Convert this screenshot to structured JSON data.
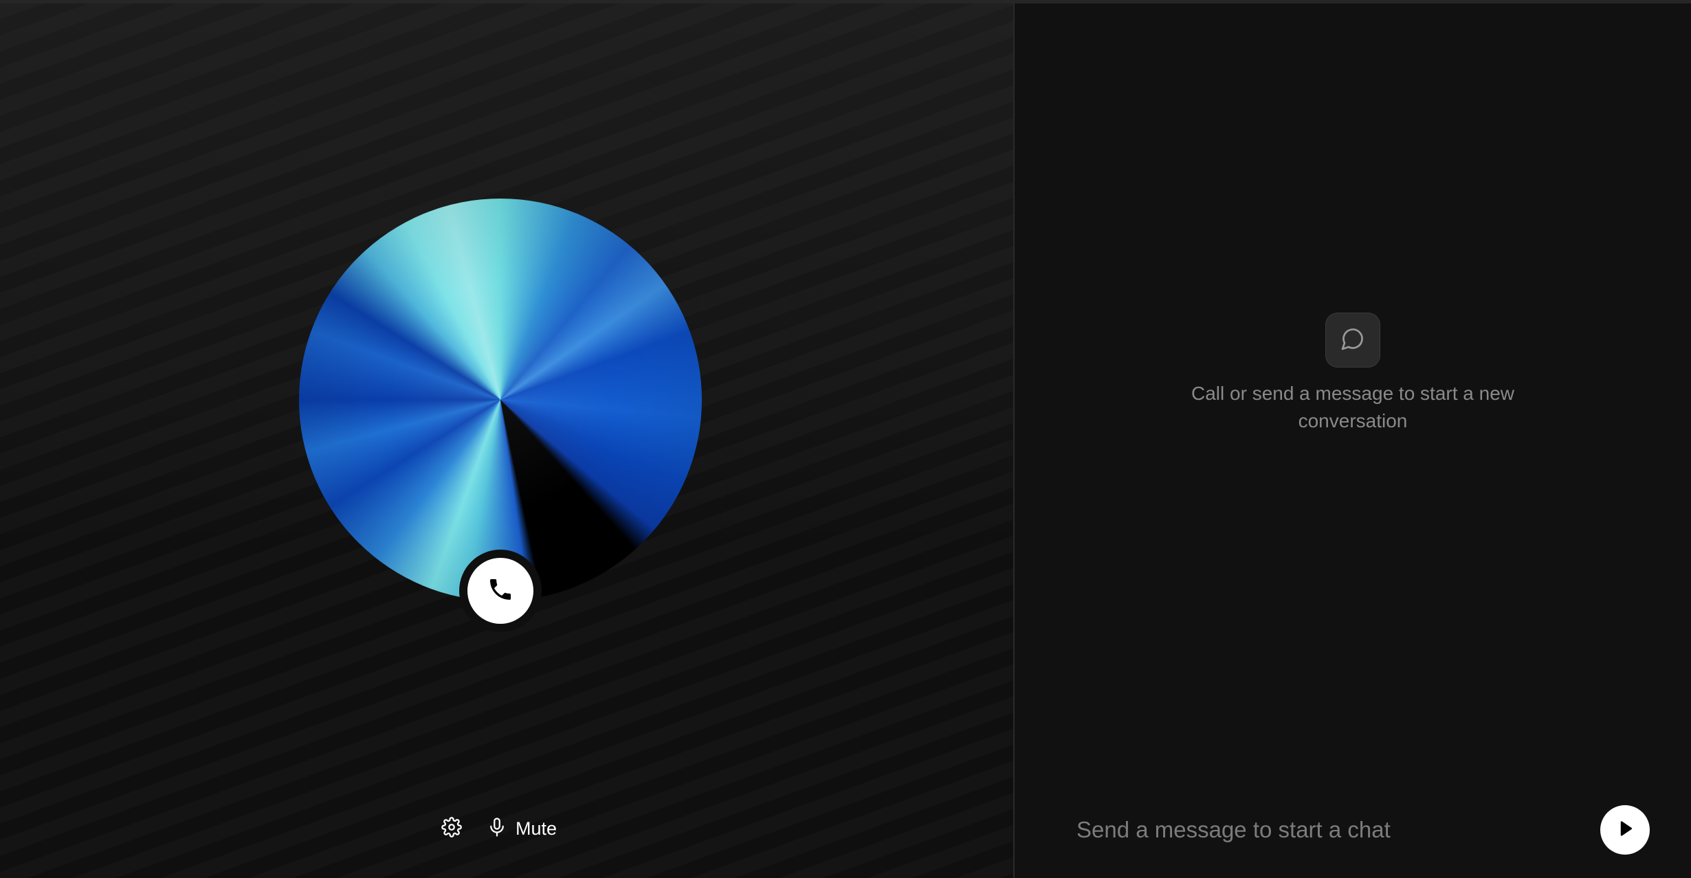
{
  "voice_panel": {
    "call_button_icon": "phone-icon",
    "settings_icon": "gear-icon",
    "mute": {
      "icon": "microphone-icon",
      "label": "Mute"
    }
  },
  "chat_panel": {
    "empty_state": {
      "icon": "chat-bubble-icon",
      "text": "Call or send a message to start a new conversation"
    },
    "composer": {
      "placeholder": "Send a message to start a chat",
      "value": "",
      "send_icon": "play-send-icon"
    }
  },
  "colors": {
    "background": "#0f0f0f",
    "orb_light": "#7ee3e8",
    "orb_dark": "#0a3aa5",
    "button": "#ffffff"
  }
}
